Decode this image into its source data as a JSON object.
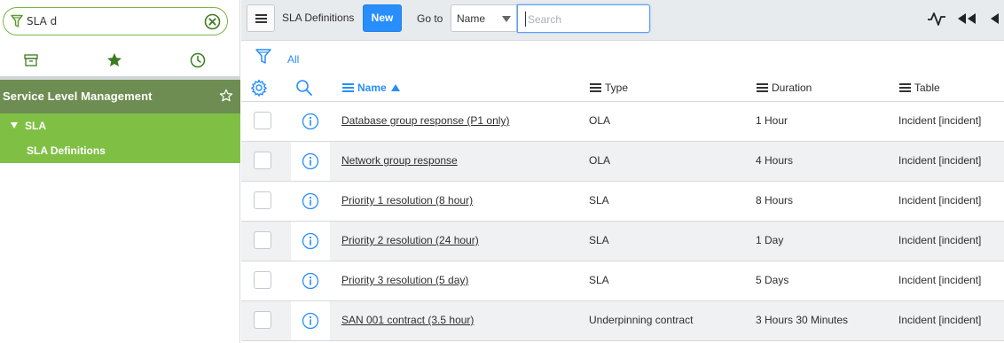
{
  "navigator": {
    "filter_value": "SLA d",
    "tabs": [
      {
        "icon": "archive-icon"
      },
      {
        "icon": "star-icon"
      },
      {
        "icon": "clock-icon"
      }
    ],
    "application": "Service Level Management",
    "modules": {
      "group": "SLA",
      "item": "SLA Definitions"
    },
    "colors": {
      "app_header": "#6d8d52",
      "module_bg": "#7fc044",
      "accent_border": "#78b642"
    }
  },
  "toolbar": {
    "title": "SLA Definitions",
    "new_label": "New",
    "goto_label": "Go to",
    "goto_selected": "Name",
    "search_placeholder": "Search",
    "right_icons": [
      "activity-icon",
      "double-left-arrow-icon",
      "collapse-left-icon"
    ]
  },
  "breadcrumb": {
    "label": "All"
  },
  "table": {
    "columns": [
      {
        "label": "Name",
        "sorted": "ascending"
      },
      {
        "label": "Type"
      },
      {
        "label": "Duration"
      },
      {
        "label": "Table"
      }
    ],
    "rows": [
      {
        "name": "Database group response (P1 only)",
        "type": "OLA",
        "duration": "1 Hour",
        "table": "Incident [incident]"
      },
      {
        "name": "Network group response",
        "type": "OLA",
        "duration": "4 Hours",
        "table": "Incident [incident]"
      },
      {
        "name": "Priority 1 resolution (8 hour)",
        "type": "SLA",
        "duration": "8 Hours",
        "table": "Incident [incident]"
      },
      {
        "name": "Priority 2 resolution (24 hour)",
        "type": "SLA",
        "duration": "1 Day",
        "table": "Incident [incident]"
      },
      {
        "name": "Priority 3 resolution (5 day)",
        "type": "SLA",
        "duration": "5 Days",
        "table": "Incident [incident]"
      },
      {
        "name": "SAN 001 contract (3.5 hour)",
        "type": "Underpinning contract",
        "duration": "3 Hours 30 Minutes",
        "table": "Incident [incident]"
      }
    ]
  },
  "colors": {
    "primary_blue": "#278efc",
    "row_alt": "#f0f1f2",
    "topbar": "#e8ebee"
  }
}
